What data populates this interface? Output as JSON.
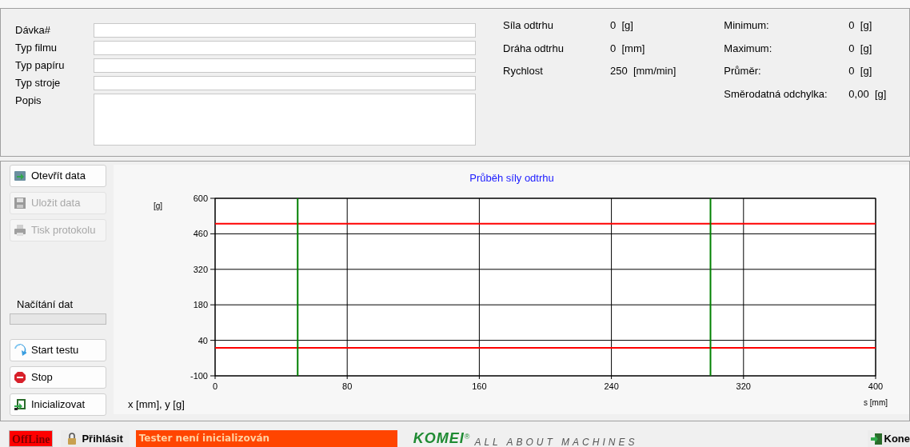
{
  "form": {
    "fields": [
      {
        "label": "Dávka#",
        "kind": "input"
      },
      {
        "label": "Typ filmu",
        "kind": "input"
      },
      {
        "label": "Typ papíru",
        "kind": "input"
      },
      {
        "label": "Typ stroje",
        "kind": "input"
      },
      {
        "label": "Popis",
        "kind": "textarea"
      }
    ]
  },
  "readings": [
    {
      "label": "Síla odtrhu",
      "value": "0",
      "unit": "[g]"
    },
    {
      "label": "Dráha odtrhu",
      "value": "0",
      "unit": "[mm]"
    },
    {
      "label": "Rychlost",
      "value": "250",
      "unit": "[mm/min]"
    }
  ],
  "statistics": [
    {
      "label": "Minimum:",
      "value": "0",
      "unit": "[g]"
    },
    {
      "label": "Maximum:",
      "value": "0",
      "unit": "[g]"
    },
    {
      "label": "Průměr:",
      "value": "0",
      "unit": "[g]"
    },
    {
      "label": "Směrodatná odchylka:",
      "value": "0,00",
      "unit": "[g]"
    }
  ],
  "file_buttons": [
    {
      "label": "Otevřít data",
      "kind": "open",
      "disabled": false
    },
    {
      "label": "Uložit data",
      "kind": "save",
      "disabled": true
    },
    {
      "label": "Tisk protokolu",
      "kind": "print",
      "disabled": true
    }
  ],
  "loading": {
    "label": "Načítání dat"
  },
  "test_buttons": [
    {
      "label": "Start testu",
      "kind": "start",
      "disabled": false
    },
    {
      "label": "Stop",
      "kind": "stop",
      "disabled": false
    },
    {
      "label": "Inicializovat",
      "kind": "init",
      "disabled": false
    }
  ],
  "chart": {
    "axes_note": "x [mm], y [g]",
    "chart_data": {
      "type": "line",
      "title": "Průběh síly odtrhu",
      "xlabel": "s [mm]",
      "ylabel": "[g]",
      "xlim": [
        0,
        400
      ],
      "ylim": [
        -100,
        600
      ],
      "xticks": [
        0,
        80,
        160,
        240,
        320,
        400
      ],
      "yticks": [
        -100,
        40,
        180,
        320,
        460,
        600
      ],
      "grid": true,
      "ref_lines": [
        {
          "axis": "y",
          "value": 500,
          "color": "#ff0000"
        },
        {
          "axis": "y",
          "value": 10,
          "color": "#ff0000"
        },
        {
          "axis": "x",
          "value": 50,
          "color": "#008000"
        },
        {
          "axis": "x",
          "value": 300,
          "color": "#008000"
        }
      ]
    }
  },
  "status_bar": {
    "connection": "OffLine",
    "online": false,
    "login": "Přihlásit",
    "message": "Tester není inicializován",
    "logo": "KOMEI",
    "logo_mark": "®",
    "slogan": "ALL ABOUT MACHINES",
    "exit": "Kone"
  }
}
